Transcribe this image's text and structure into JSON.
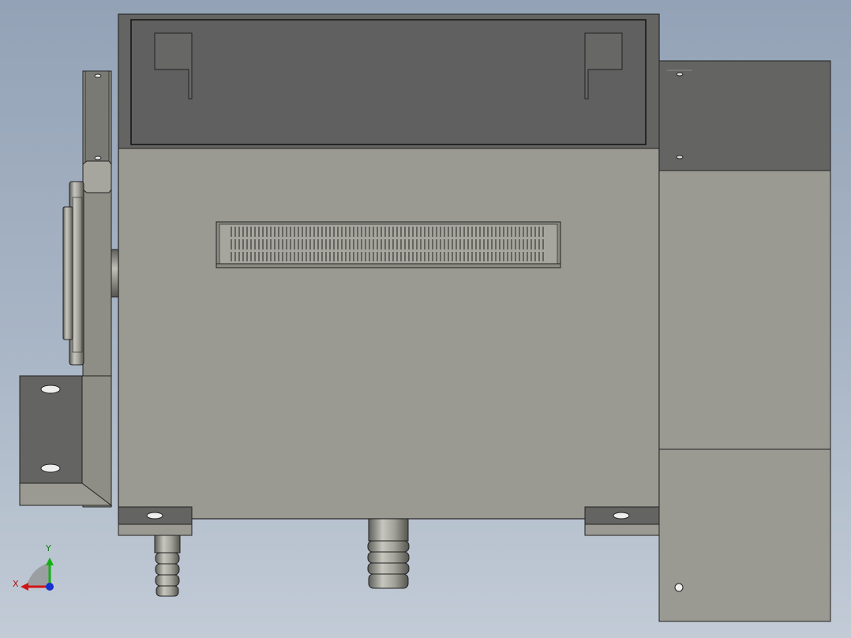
{
  "viewport": {
    "background_top": "#93a2b6",
    "background_bottom": "#c2cbd6",
    "body_color": "#9a9a92",
    "dark_panel_color": "#646462",
    "edge_color": "#222222"
  },
  "triad": {
    "x_label": "X",
    "y_label": "Y",
    "x_color": "#d01515",
    "y_color": "#15b015",
    "z_color": "#1530d0"
  }
}
